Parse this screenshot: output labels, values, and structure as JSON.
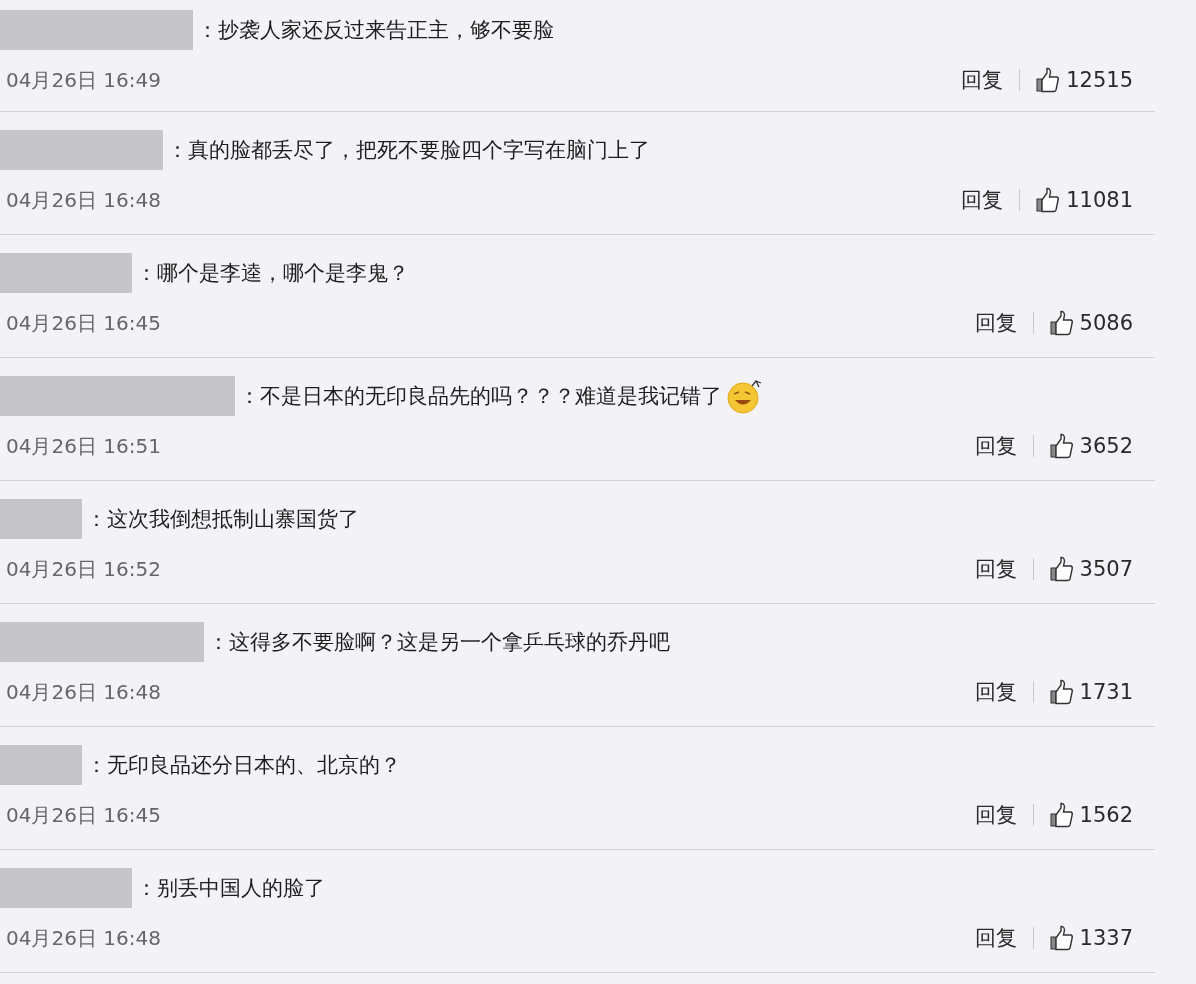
{
  "comments": [
    {
      "text": "：抄袭人家还反过来告正主，够不要脸",
      "emoji": false,
      "time": "04月26日 16:49",
      "reply": "回复",
      "likes": "12515"
    },
    {
      "text": "：真的脸都丢尽了，把死不要脸四个字写在脑门上了",
      "emoji": false,
      "time": "04月26日 16:48",
      "reply": "回复",
      "likes": "11081"
    },
    {
      "text": "：哪个是李逵，哪个是李鬼？",
      "emoji": false,
      "time": "04月26日 16:45",
      "reply": "回复",
      "likes": "5086"
    },
    {
      "text": "：不是日本的无印良品先的吗？？？难道是我记错了",
      "emoji": true,
      "time": "04月26日 16:51",
      "reply": "回复",
      "likes": "3652"
    },
    {
      "text": "：这次我倒想抵制山寨国货了",
      "emoji": false,
      "time": "04月26日 16:52",
      "reply": "回复",
      "likes": "3507"
    },
    {
      "text": "：这得多不要脸啊？这是另一个拿乒乓球的乔丹吧",
      "emoji": false,
      "time": "04月26日 16:48",
      "reply": "回复",
      "likes": "1731"
    },
    {
      "text": "：无印良品还分日本的、北京的？",
      "emoji": false,
      "time": "04月26日 16:45",
      "reply": "回复",
      "likes": "1562"
    },
    {
      "text": "：别丢中国人的脸了",
      "emoji": false,
      "time": "04月26日 16:48",
      "reply": "回复",
      "likes": "1337"
    }
  ]
}
